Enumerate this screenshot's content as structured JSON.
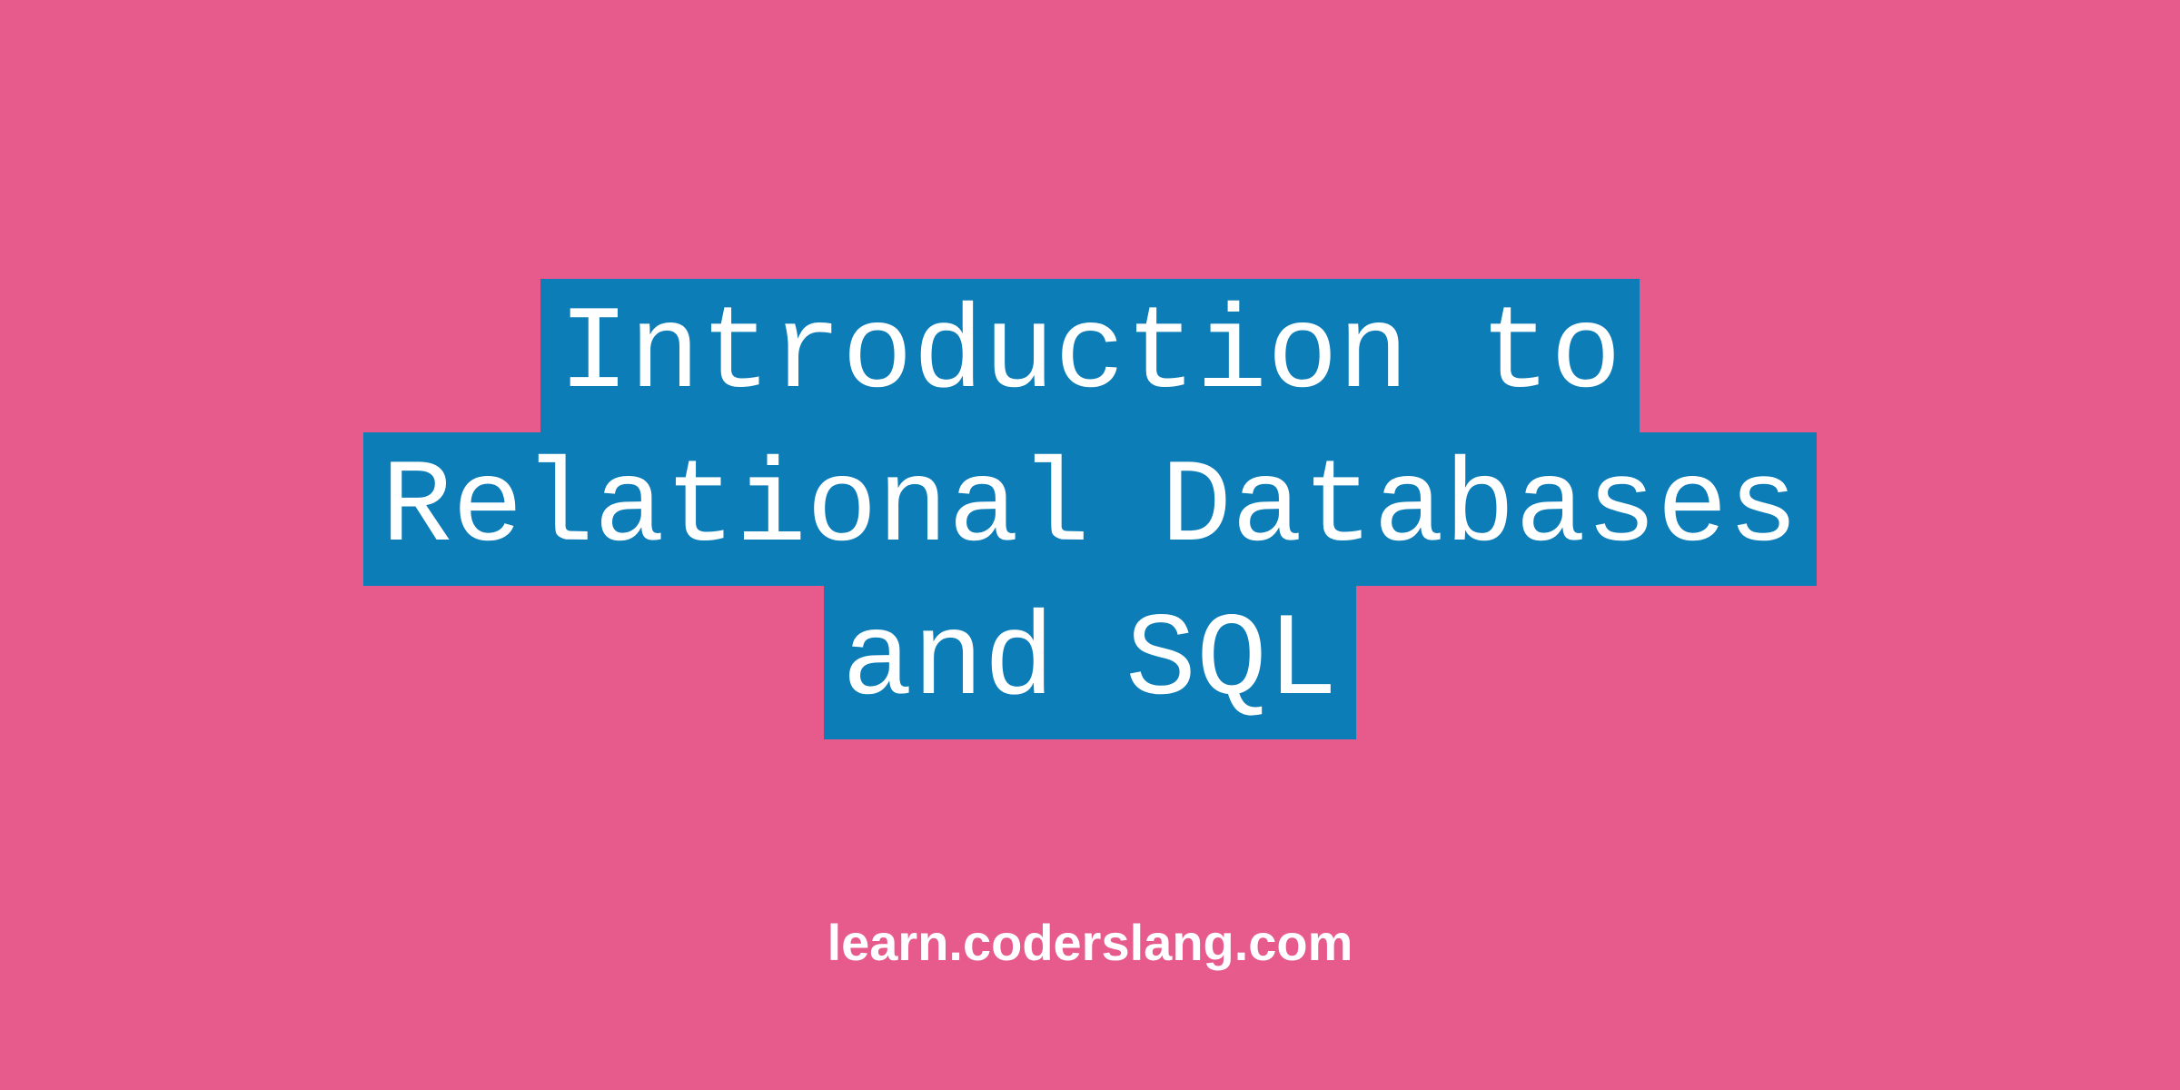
{
  "title": {
    "line1": "Introduction to",
    "line2": "Relational Databases",
    "line3": "and SQL"
  },
  "footer": {
    "text": "learn.coderslang.com"
  },
  "colors": {
    "background": "#e75a8c",
    "highlight": "#0d7db8",
    "text": "#ffffff"
  }
}
